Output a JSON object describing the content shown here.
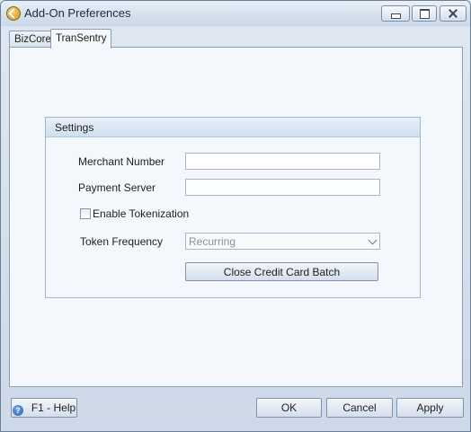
{
  "window": {
    "title": "Add-On Preferences"
  },
  "tabs": [
    {
      "label": "BizCore",
      "selected": false
    },
    {
      "label": "TranSentry",
      "selected": true
    }
  ],
  "settings": {
    "title": "Settings",
    "merchant_number_label": "Merchant Number",
    "merchant_number_value": "",
    "payment_server_label": "Payment Server",
    "payment_server_value": "",
    "enable_tokenization_label": "Enable Tokenization",
    "enable_tokenization_checked": false,
    "token_frequency_label": "Token Frequency",
    "token_frequency_value": "Recurring",
    "close_batch_label": "Close Credit Card Batch"
  },
  "footer": {
    "help_label": "F1 - Help",
    "ok_label": "OK",
    "cancel_label": "Cancel",
    "apply_label": "Apply"
  },
  "icons": {
    "app": "app-logo-icon",
    "help": "help-icon",
    "minimize": "minimize-icon",
    "maximize": "maximize-icon",
    "close": "close-icon",
    "dropdown": "chevron-down-icon"
  }
}
